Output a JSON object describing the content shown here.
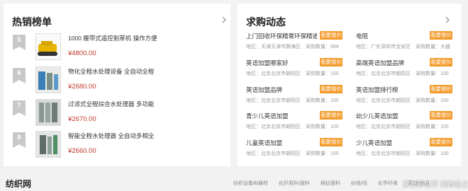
{
  "colors": {
    "accent": "#f39a29",
    "price": "#c0392b",
    "badge": "#c8c8c8"
  },
  "hot_list": {
    "title": "热销榜单",
    "more_icon": "chevron-right-icon",
    "items": [
      {
        "rank": "5",
        "name": "1000 履带式遥控割草机 操作方便",
        "price": "¥4800.00"
      },
      {
        "rank": "6",
        "name": "物化全程水处理设备 全自动全程",
        "price": "¥2680.00"
      },
      {
        "rank": "7",
        "name": "过滤式全程综合水处理器 多功能",
        "price": "¥2670.00"
      },
      {
        "rank": "8",
        "name": "智能全程水处理器 全自动多相全",
        "price": "¥2660.00"
      }
    ]
  },
  "requests": {
    "title": "求购动态",
    "more_icon": "chevron-right-icon",
    "button_label": "我要报价",
    "items": [
      {
        "title": "上门回收环保精膏环保精道...",
        "area": "地区：天津天津市静海区",
        "qty": "采购数量：999"
      },
      {
        "title": "电阻",
        "area": "地区：广东深圳市宝安区",
        "qty": "采购数量：大器"
      },
      {
        "title": "英语加盟哪家好",
        "area": "地区：北京北京市朝阳区",
        "qty": "采购数量：100"
      },
      {
        "title": "高端英语加盟品牌",
        "area": "地区：北京北京市朝阳区",
        "qty": "采购数量：100"
      },
      {
        "title": "英语加盟品牌",
        "area": "地区：北京北京市朝阳区",
        "qty": "采购数量：100"
      },
      {
        "title": "英语加盟排行榜",
        "area": "地区：北京北京市朝阳区",
        "qty": "采购数量：100"
      },
      {
        "title": "青少儿英语加盟",
        "area": "地区：北京北京市朝阳区",
        "qty": "采购数量：100"
      },
      {
        "title": "幼少儿英语加盟",
        "area": "地区：北京北京市朝阳区",
        "qty": "采购数量：100"
      },
      {
        "title": "儿童英语加盟",
        "area": "地区：北京北京市朝阳区",
        "qty": "采购数量：100"
      },
      {
        "title": "少儿英语加盟",
        "area": "地区：北京北京市朝阳区",
        "qty": "采购数量：100"
      }
    ]
  },
  "bottom": {
    "title": "纺织网",
    "links": [
      "纺织设备和器材",
      "化纤原料/面料",
      "棉纺面料",
      "纱线/线",
      "化学纤维",
      "家纺/床品"
    ],
    "watermark": "家纺新世界 韩博会之家"
  }
}
